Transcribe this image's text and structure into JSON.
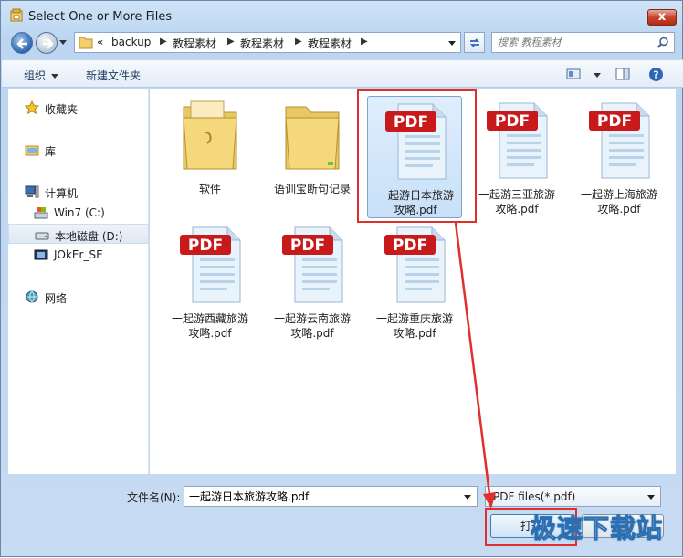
{
  "window": {
    "title": "Select One or More Files",
    "close_label": "x"
  },
  "address": {
    "overflow": "«",
    "crumbs": [
      "backup",
      "教程素材",
      "教程素材",
      "教程素材"
    ]
  },
  "search": {
    "placeholder": "搜索 教程素材"
  },
  "toolbar": {
    "organize_label": "组织",
    "new_folder_label": "新建文件夹"
  },
  "sidebar": {
    "items": [
      {
        "label": "收藏夹",
        "icon": "star-icon"
      },
      {
        "label": "库",
        "icon": "library-icon"
      },
      {
        "label": "计算机",
        "icon": "computer-icon"
      },
      {
        "label": "Win7 (C:)",
        "icon": "system-drive-icon"
      },
      {
        "label": "本地磁盘 (D:)",
        "icon": "drive-icon",
        "selected": true
      },
      {
        "label": "JOkEr_SE",
        "icon": "removable-drive-icon"
      },
      {
        "label": "网络",
        "icon": "network-icon"
      }
    ]
  },
  "files": [
    {
      "name": "软件",
      "type": "folder"
    },
    {
      "name": "语训宝断句记录",
      "type": "folder"
    },
    {
      "name": "一起游日本旅游\n攻略.pdf",
      "type": "pdf",
      "selected": true
    },
    {
      "name": "一起游三亚旅游\n攻略.pdf",
      "type": "pdf"
    },
    {
      "name": "一起游上海旅游\n攻略.pdf",
      "type": "pdf"
    },
    {
      "name": "一起游西藏旅游\n攻略.pdf",
      "type": "pdf"
    },
    {
      "name": "一起游云南旅游\n攻略.pdf",
      "type": "pdf"
    },
    {
      "name": "一起游重庆旅游\n攻略.pdf",
      "type": "pdf"
    }
  ],
  "pdf_badge": "PDF",
  "bottom": {
    "filename_label": "文件名(N):",
    "filename_value": "一起游日本旅游攻略.pdf",
    "filetype_value": "PDF files(*.pdf)",
    "open_label": "打开",
    "cancel_label": ""
  },
  "watermark": "极速下载站",
  "colors": {
    "highlight": "#e0302e",
    "pdf_red": "#c8191b",
    "selection": "#cce4f8"
  }
}
